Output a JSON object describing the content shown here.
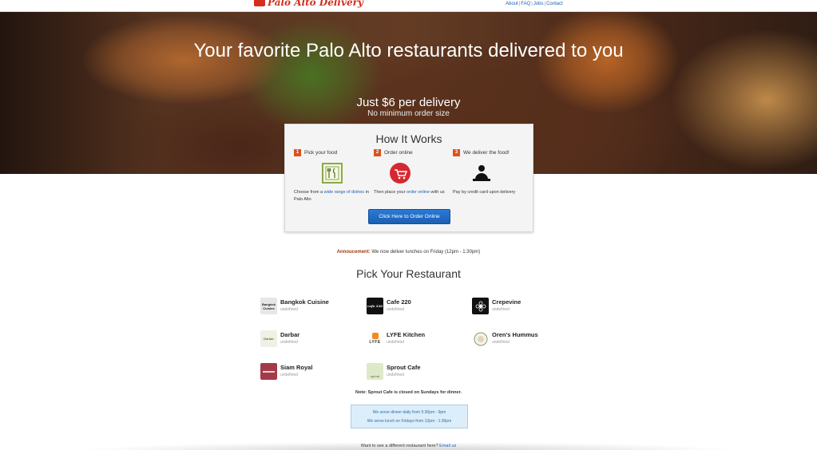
{
  "header": {
    "logo_text": "Palo Alto Delivery",
    "links": [
      "About",
      "FAQ",
      "Jobs",
      "Contact"
    ]
  },
  "hero": {
    "title": "Your favorite Palo Alto restaurants delivered to you",
    "price": "Just $6 per delivery",
    "subtitle": "No minimum order size"
  },
  "how_it_works": {
    "title": "How It Works",
    "steps": [
      {
        "num": "1",
        "label": "Pick your food",
        "desc_pre": "Choose from a ",
        "desc_link": "wide range of dishes",
        "desc_post": " in Palo Alto",
        "icon": "menu-icon"
      },
      {
        "num": "2",
        "label": "Order online",
        "desc_pre": "Then place your ",
        "desc_link": "order online",
        "desc_post": " with us",
        "icon": "cart-icon"
      },
      {
        "num": "3",
        "label": "We deliver the food!",
        "desc_pre": "Pay by credit card upon delivery",
        "desc_link": "",
        "desc_post": "",
        "icon": "delivery-person-icon"
      }
    ],
    "button": "Click Here to Order Online"
  },
  "announcement": {
    "label": "Annoucement:",
    "text": " We now deliver lunches on Friday (12pm - 1:30pm)"
  },
  "restaurants_title": "Pick Your Restaurant",
  "restaurants": [
    {
      "name": "Bangkok Cuisine",
      "sub": "undefined",
      "logo": "Bangkok Cuisine"
    },
    {
      "name": "Cafe 220",
      "sub": "undefined",
      "logo": "cafe 220"
    },
    {
      "name": "Crepevine",
      "sub": "undefined",
      "logo": ""
    },
    {
      "name": "Darbar",
      "sub": "undefined",
      "logo": "Darbar"
    },
    {
      "name": "LYFE Kitchen",
      "sub": "undefined",
      "logo": "LYFE"
    },
    {
      "name": "Oren's Hummus",
      "sub": "undefined",
      "logo": ""
    },
    {
      "name": "Siam Royal",
      "sub": "undefined",
      "logo": ""
    },
    {
      "name": "Sprout Cafe",
      "sub": "undefined",
      "logo": "sprout"
    }
  ],
  "note": "Note: Sprout Cafe is closed on Sundays for dinner.",
  "hours": [
    "We serve dinner daily from 5:30pm - 9pm",
    "We serve lunch on Fridays from 12pm - 1:30pm"
  ],
  "footer": {
    "text": "Want to see a different restaurant here? ",
    "link": "Email us"
  },
  "colors": {
    "brand_red": "#d32f1f",
    "step_orange": "#d9531e",
    "link_blue": "#1a5fb4"
  }
}
